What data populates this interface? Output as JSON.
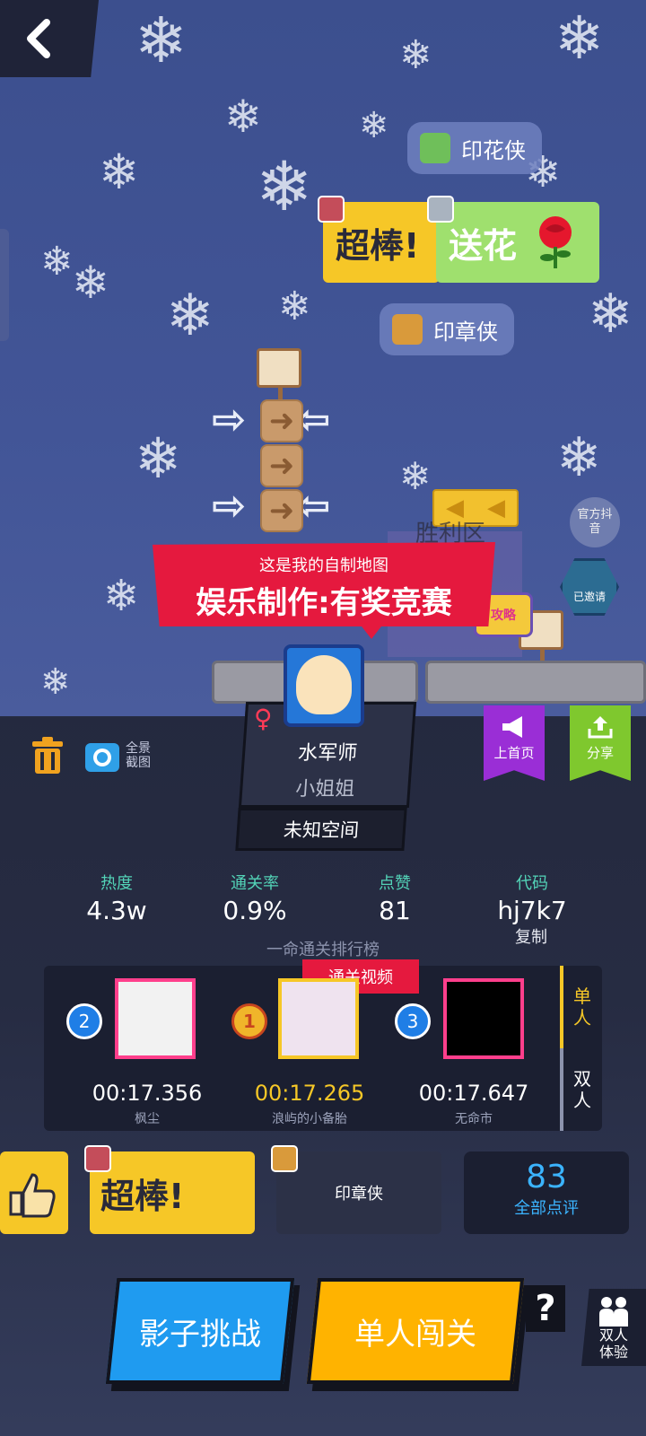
{
  "scene": {
    "bubbles": [
      {
        "label": "印花侠"
      },
      {
        "label": "印章侠"
      }
    ],
    "chaobang_label": "超棒!",
    "songhua_label": "送花",
    "victory_label": "胜利区",
    "tv_label": "攻略",
    "official_label": "官方抖音",
    "badge_label": "已邀请"
  },
  "promo": {
    "subtitle": "这是我的自制地图",
    "title": "娱乐制作:有奖竞赛"
  },
  "toolbar": {
    "panorama_label": "全景截图"
  },
  "profile": {
    "name": "水军师",
    "title": "小姐姐",
    "space": "未知空间"
  },
  "actions": {
    "homepage_label": "上首页",
    "share_label": "分享"
  },
  "stats": [
    {
      "label": "热度",
      "value": "4.3w"
    },
    {
      "label": "通关率",
      "value": "0.9%"
    },
    {
      "label": "点赞",
      "value": "81"
    },
    {
      "label": "代码",
      "value": "hj7k7"
    }
  ],
  "copy_label": "复制",
  "ranking": {
    "title": "一命通关排行榜",
    "video_tag": "通关视频",
    "entries": [
      {
        "rank": "2",
        "time": "00:17.356",
        "name": "枫尘"
      },
      {
        "rank": "1",
        "time": "00:17.265",
        "name": "浪屿的小备胎"
      },
      {
        "rank": "3",
        "time": "00:17.647",
        "name": "无命市"
      }
    ],
    "modes": [
      "单人",
      "双人"
    ]
  },
  "reactions": {
    "chaobang": "超棒!",
    "stamp_user": "印章侠",
    "review_count": "83",
    "review_label": "全部点评"
  },
  "buttons": {
    "shadow": "影子挑战",
    "single": "单人闯关",
    "help": "?",
    "duo": "双人体验"
  },
  "colors": {
    "accent_red": "#e5193e",
    "accent_yellow": "#f6c727",
    "accent_blue": "#1f9bf0",
    "accent_orange": "#ffb300",
    "purple": "#9a2ed6",
    "green": "#7fc82e",
    "teal_label": "#53d3b7"
  }
}
